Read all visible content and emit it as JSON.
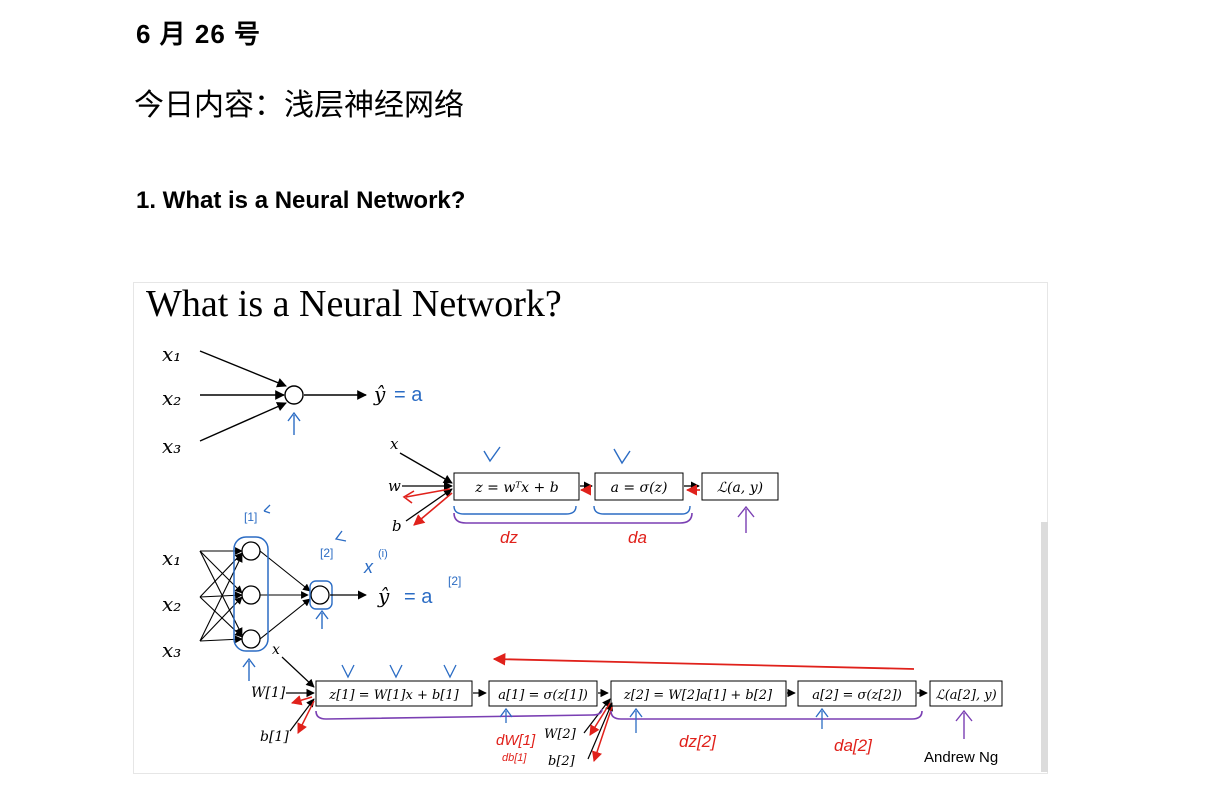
{
  "document": {
    "date": "6 月 26 号",
    "topic": "今日内容：浅层神经网络",
    "section_heading": "1. What is a Neural Network?"
  },
  "slide": {
    "title": "What is a Neural Network?",
    "footer": "Andrew Ng",
    "single_neuron": {
      "inputs": [
        "x₁",
        "x₂",
        "x₃"
      ],
      "output": "ŷ",
      "output_annotation": "= a"
    },
    "logistic_graph": {
      "inputs": [
        "x",
        "w",
        "b"
      ],
      "boxes": [
        "z = wᵀx + b",
        "a = σ(z)",
        "ℒ(a, y)"
      ],
      "backprop_labels": [
        "dz",
        "da"
      ]
    },
    "two_layer_net": {
      "inputs": [
        "x₁",
        "x₂",
        "x₃"
      ],
      "output": "ŷ",
      "output_annotation": "= a",
      "output_superscript": "[2]",
      "layer1_tag": "[1]",
      "layer2_tag": "[2]",
      "sample_note": "x",
      "sample_superscript": "(i)"
    },
    "deep_graph": {
      "x_label": "x",
      "params_layer1": [
        "W[1]",
        "b[1]"
      ],
      "params_layer2": [
        "W[2]",
        "b[2]"
      ],
      "boxes": [
        "z[1] = W[1]x + b[1]",
        "a[1] = σ(z[1])",
        "z[2] = W[2]a[1] + b[2]",
        "a[2] = σ(z[2])",
        "ℒ(a[2], y)"
      ],
      "backprop_labels": [
        "dW[1]",
        "db[1]",
        "dz[2]",
        "da[2]"
      ]
    }
  },
  "colors": {
    "ink": "#000000",
    "blue_annotation": "#2b6cc4",
    "red_annotation": "#e0211b",
    "purple_brace": "#7a3fb3"
  }
}
